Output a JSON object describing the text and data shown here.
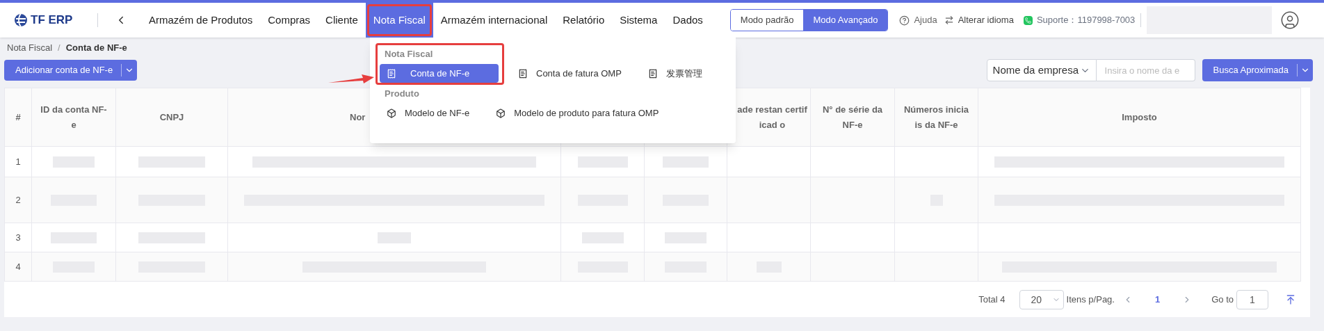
{
  "app": {
    "logo": "TF ERP"
  },
  "nav": [
    {
      "label": "Armazém de Produtos",
      "selected": false
    },
    {
      "label": "Compras",
      "selected": false
    },
    {
      "label": "Cliente",
      "selected": false
    },
    {
      "label": "Nota Fiscal",
      "selected": true
    },
    {
      "label": "Armazém internacional",
      "selected": false
    },
    {
      "label": "Relatório",
      "selected": false
    },
    {
      "label": "Sistema",
      "selected": false
    },
    {
      "label": "Dados",
      "selected": false
    }
  ],
  "modes": [
    {
      "label": "Modo padrão",
      "selected": false
    },
    {
      "label": "Modo Avançado",
      "selected": true
    }
  ],
  "help": "Ajuda",
  "language": "Alterar idioma",
  "support": "Suporte：1197998-7003",
  "breadcrumb": [
    "Nota Fiscal",
    "Conta de NF-e"
  ],
  "breadcrumb_separator": "/",
  "add_button": "Adicionar conta de NF-e",
  "search": {
    "field": "Nome da empresa",
    "placeholder": "Insira o nome da e",
    "button": "Busca Aproximada"
  },
  "menu": {
    "groups": [
      {
        "title": "Nota Fiscal",
        "items": [
          {
            "label": "Conta de NF-e",
            "selected": true
          },
          {
            "label": "Conta de fatura OMP",
            "selected": false
          },
          {
            "label": "发票管理",
            "selected": false
          }
        ]
      },
      {
        "title": "Produto",
        "items": [
          {
            "label": "Modelo de NF-e",
            "selected": false
          },
          {
            "label": "Modelo de produto para fatura OMP",
            "selected": false
          }
        ]
      }
    ]
  },
  "table": {
    "columns": [
      {
        "label": "#"
      },
      {
        "label": "ID da conta NF-e"
      },
      {
        "label": "CNPJ"
      },
      {
        "label": "Nor"
      },
      {},
      {},
      {
        "label": "ade restan certificad o"
      },
      {
        "label": "N° de série da NF-e"
      },
      {
        "label": "Números iniciais da NF-e"
      },
      {
        "label": "Imposto"
      }
    ],
    "rows": [
      {
        "number": "1"
      },
      {
        "number": "2"
      },
      {
        "number": "3"
      },
      {
        "number": "4"
      }
    ]
  },
  "pagination": {
    "total": "Total 4",
    "page_size": "20",
    "per_page": "Itens p/Pag.",
    "current": "1",
    "goto_label": "Go to",
    "goto_value": "1"
  }
}
